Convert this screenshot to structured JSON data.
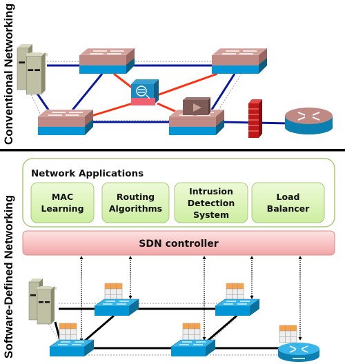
{
  "sections": {
    "conventional": {
      "label": "Conventional Networking"
    },
    "sdn": {
      "label": "Software-Defined Networking"
    }
  },
  "applications": {
    "title": "Network Applications",
    "items": [
      {
        "lines": [
          "MAC",
          "Learning"
        ]
      },
      {
        "lines": [
          "Routing",
          "Algorithms"
        ]
      },
      {
        "lines": [
          "Intrusion",
          "Detection",
          "System"
        ]
      },
      {
        "lines": [
          "Load",
          "Balancer"
        ]
      }
    ]
  },
  "controller": {
    "label": "SDN controller"
  },
  "colors": {
    "switch_top": "#c08a84",
    "switch_body": "#0096d6",
    "link_conventional": "#0a1aa0",
    "link_middlebox": "#ff3010",
    "link_sdn": "#000000",
    "app_fill": "#dff5b8",
    "app_border": "#9ec46a",
    "controller_fill": "#f9c4c4",
    "flow_table_header": "#f6a24a"
  },
  "icons": [
    "server-icon",
    "switch-icon",
    "router-icon",
    "firewall-icon",
    "ids-firewall-icon",
    "load-balancer-icon",
    "flow-table-icon",
    "openflow-switch-icon"
  ]
}
